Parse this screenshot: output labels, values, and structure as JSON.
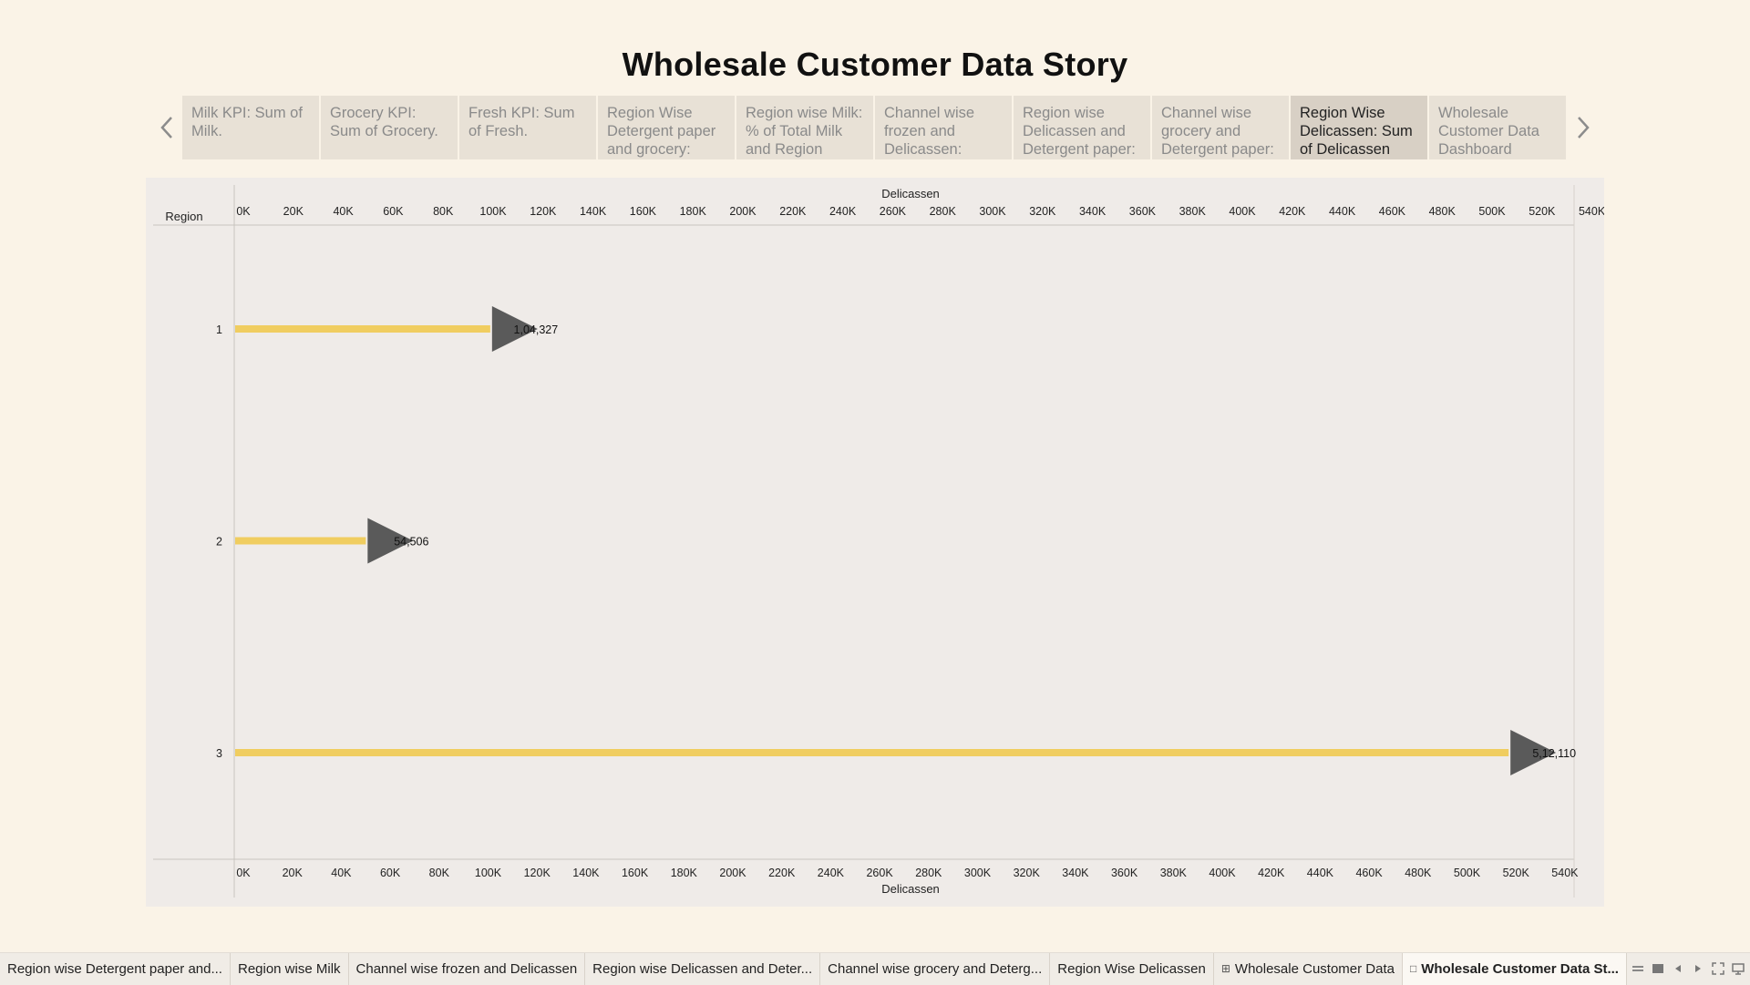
{
  "story": {
    "title": "Wholesale Customer Data Story"
  },
  "story_points": [
    {
      "label": "Milk KPI: Sum of Milk.",
      "active": false
    },
    {
      "label": "Grocery KPI: Sum of Grocery.",
      "active": false
    },
    {
      "label": "Fresh KPI: Sum of Fresh.",
      "active": false
    },
    {
      "label": "Region Wise Detergent paper and grocery:",
      "active": false
    },
    {
      "label": "Region wise Milk: % of Total Milk and Region",
      "active": false
    },
    {
      "label": "Channel wise frozen and Delicassen:",
      "active": false
    },
    {
      "label": "Region wise Delicassen and Detergent paper:",
      "active": false
    },
    {
      "label": "Channel wise grocery and Detergent paper:",
      "active": false
    },
    {
      "label": "Region Wise Delicassen: Sum of Delicassen",
      "active": true
    },
    {
      "label": "Wholesale Customer Data Dashboard",
      "active": false
    }
  ],
  "sheet_tabs": [
    {
      "label": "Region wise Detergent paper and...",
      "icon": "",
      "active": false
    },
    {
      "label": "Region wise Milk",
      "icon": "",
      "active": false
    },
    {
      "label": "Channel wise frozen and Delicassen",
      "icon": "",
      "active": false
    },
    {
      "label": "Region wise Delicassen and Deter...",
      "icon": "",
      "active": false
    },
    {
      "label": "Channel wise grocery and Deterg...",
      "icon": "",
      "active": false
    },
    {
      "label": "Region Wise Delicassen",
      "icon": "",
      "active": false
    },
    {
      "label": "Wholesale Customer Data",
      "icon": "dashboard-icon",
      "active": false
    },
    {
      "label": "Wholesale Customer Data St...",
      "icon": "story-icon",
      "active": true
    }
  ],
  "chart_data": {
    "type": "bar",
    "orientation": "horizontal",
    "row_header": "Region",
    "xlabel": "Delicassen",
    "categories": [
      "1",
      "2",
      "3"
    ],
    "values": [
      104327,
      54506,
      512110
    ],
    "value_labels": [
      "1,04,327",
      "54,506",
      "5,12,110"
    ],
    "xlim": [
      0,
      540000
    ],
    "xticks_top": [
      "0K",
      "20K",
      "40K",
      "60K",
      "80K",
      "100K",
      "120K",
      "140K",
      "160K",
      "180K",
      "200K",
      "220K",
      "240K",
      "260K",
      "280K",
      "300K",
      "320K",
      "340K",
      "360K",
      "380K",
      "400K",
      "420K",
      "440K",
      "460K",
      "480K",
      "500K",
      "520K",
      "540K"
    ],
    "xticks_bottom": [
      "0K",
      "20K",
      "40K",
      "60K",
      "80K",
      "100K",
      "120K",
      "140K",
      "160K",
      "180K",
      "200K",
      "220K",
      "240K",
      "260K",
      "280K",
      "300K",
      "320K",
      "340K",
      "360K",
      "380K",
      "400K",
      "420K",
      "440K",
      "460K",
      "480K",
      "500K",
      "520K",
      "540K"
    ],
    "bar_color": "#f0cd60",
    "marker_color": "#5a5a5a",
    "grid": false
  }
}
